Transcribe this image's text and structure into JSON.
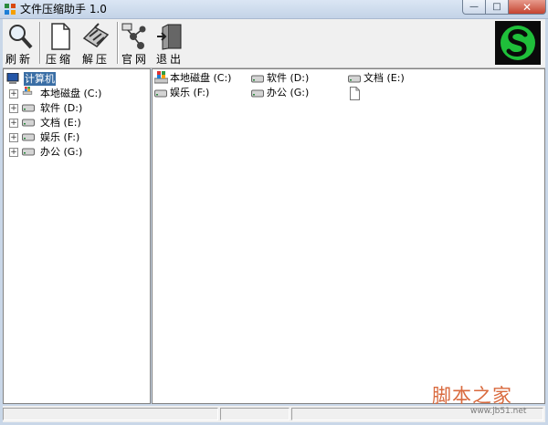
{
  "window": {
    "title": "文件压缩助手 1.0",
    "min_glyph": "—",
    "max_glyph": "□",
    "close_glyph": "✕"
  },
  "toolbar": {
    "refresh_label": "刷新",
    "compress_label": "压缩",
    "extract_label": "解压",
    "website_label": "官网",
    "exit_label": "退出"
  },
  "tree": {
    "root_label": "计算机",
    "expander_glyph": "+",
    "items": [
      {
        "label": "本地磁盘 (C:)"
      },
      {
        "label": "软件 (D:)"
      },
      {
        "label": "文档 (E:)"
      },
      {
        "label": "娱乐 (F:)"
      },
      {
        "label": "办公 (G:)"
      }
    ]
  },
  "files": {
    "items": [
      {
        "label": "本地磁盘 (C:)"
      },
      {
        "label": "娱乐 (F:)"
      },
      {
        "label": "软件 (D:)"
      },
      {
        "label": "办公 (G:)"
      },
      {
        "label": "文档 (E:)"
      }
    ]
  },
  "watermark": {
    "main": "脚本之家",
    "sub": "www.jb51.net"
  }
}
